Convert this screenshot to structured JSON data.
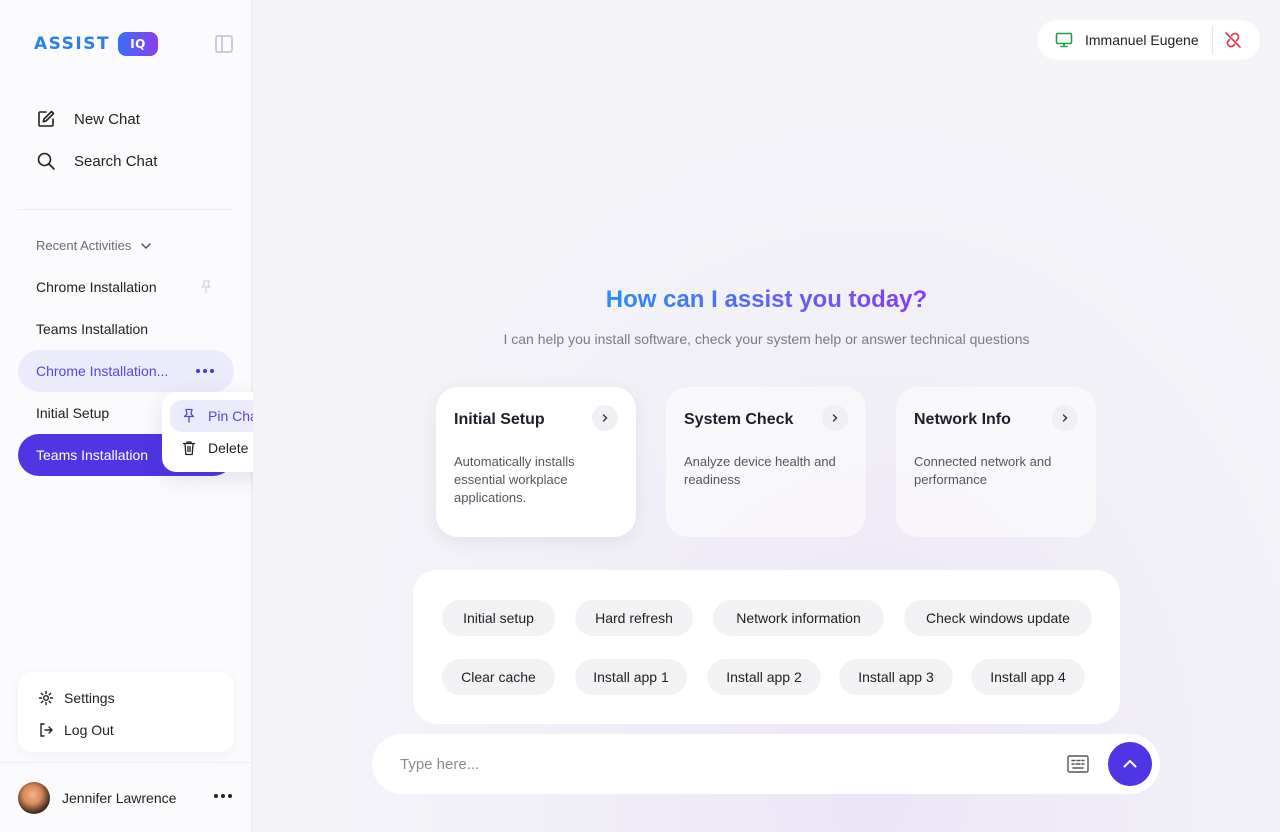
{
  "brand": {
    "name": "ASSIST",
    "badge": "IQ"
  },
  "nav": {
    "new_chat": "New Chat",
    "search_chat": "Search Chat"
  },
  "recent": {
    "heading": "Recent Activities",
    "items": [
      {
        "label": "Chrome Installation"
      },
      {
        "label": "Teams Installation"
      },
      {
        "label": "Chrome Installation..."
      },
      {
        "label": "Initial Setup"
      },
      {
        "label": "Teams Installation"
      }
    ]
  },
  "context_menu": {
    "pin": "Pin Chat",
    "delete": "Delete"
  },
  "settings": {
    "settings_label": "Settings",
    "logout_label": "Log Out"
  },
  "user": {
    "name": "Jennifer Lawrence"
  },
  "device": {
    "name": "Immanuel Eugene"
  },
  "hero": {
    "title": "How can I assist you today?",
    "subtitle": "I can help you install software, check your system help or answer technical questions"
  },
  "cards": [
    {
      "title": "Initial Setup",
      "desc": "Automatically installs essential workplace applications."
    },
    {
      "title": "System Check",
      "desc": "Analyze device health and readiness"
    },
    {
      "title": "Network Info",
      "desc": "Connected network and performance"
    }
  ],
  "chips": [
    "Initial setup",
    "Hard refresh",
    "Network information",
    "Check windows update",
    "Clear cache",
    "Install app 1",
    "Install app 2",
    "Install app 3",
    "Install app 4"
  ],
  "composer": {
    "placeholder": "Type here..."
  },
  "colors": {
    "accent": "#4f35e3",
    "accent_light": "#ecebfb",
    "device_green": "#1aa34a",
    "unlink_red": "#e0344a"
  }
}
